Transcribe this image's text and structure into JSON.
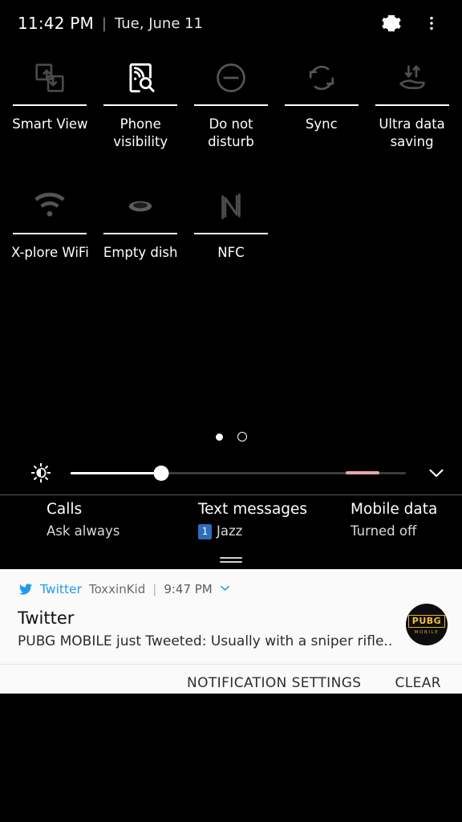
{
  "statusbar": {
    "time": "11:42 PM",
    "separator": "|",
    "date": "Tue, June 11",
    "settings_icon": "gear-icon",
    "overflow_icon": "more-vertical-icon"
  },
  "quick_settings": {
    "rows": [
      [
        {
          "label": "Smart View",
          "icon": "smart-view-icon",
          "state": "off"
        },
        {
          "label": "Phone visibility",
          "icon": "phone-visibility-icon",
          "state": "on"
        },
        {
          "label": "Do not disturb",
          "icon": "do-not-disturb-icon",
          "state": "off"
        },
        {
          "label": "Sync",
          "icon": "sync-icon",
          "state": "off"
        },
        {
          "label": "Ultra data saving",
          "icon": "ultra-data-saving-icon",
          "state": "off"
        }
      ],
      [
        {
          "label": "X-plore WiFi",
          "icon": "wifi-icon",
          "state": "off"
        },
        {
          "label": "Empty dish",
          "icon": "dish-icon",
          "state": "off"
        },
        {
          "label": "NFC",
          "icon": "nfc-icon",
          "state": "off"
        }
      ]
    ],
    "page_dots": {
      "count": 2,
      "active_index": 0
    }
  },
  "brightness": {
    "icon": "brightness-icon",
    "value_percent": 27,
    "hot_zone_start_percent": 82,
    "hot_zone_end_percent": 92,
    "expand_icon": "chevron-down-icon",
    "track_color": "#3c3c3c",
    "fill_color": "#ffffff",
    "hot_color": "#e7a7a7"
  },
  "sim_row": {
    "cells": [
      {
        "title": "Calls",
        "subtitle": "Ask always",
        "badge": ""
      },
      {
        "title": "Text messages",
        "subtitle": "Jazz",
        "badge": "1"
      },
      {
        "title": "Mobile data",
        "subtitle": "Turned off",
        "badge": ""
      }
    ]
  },
  "notification": {
    "app_name": "Twitter",
    "user": "ToxxinKid",
    "separator": "|",
    "time": "9:47 PM",
    "expand_icon": "chevron-down-icon",
    "title": "Twitter",
    "body": "PUBG MOBILE just Tweeted: Usually with a sniper rifle..",
    "thumbnail": {
      "name": "pubg-mobile-logo",
      "main_text": "PUBG",
      "sub_text": "MOBILE"
    },
    "accent_color": "#1d9bf0"
  },
  "footer": {
    "notification_settings_label": "NOTIFICATION SETTINGS",
    "clear_label": "CLEAR"
  }
}
